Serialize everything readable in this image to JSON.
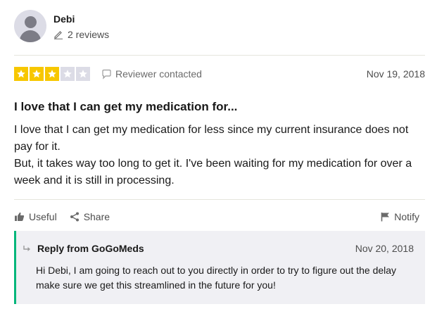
{
  "reviewer": {
    "name": "Debi",
    "review_count": "2 reviews",
    "avatar_icon": "user-avatar-icon"
  },
  "review": {
    "rating": 3,
    "rating_max": 5,
    "star_color": "#f7c700",
    "status": "Reviewer contacted",
    "date": "Nov 19, 2018",
    "title": "I love that I can get my medication for...",
    "body_line1": "I love that I can get my medication for less since my current insurance does not pay for it.",
    "body_line2": "But, it takes way too long to get it. I've been waiting for my medication for over a week and it is still in processing."
  },
  "actions": {
    "useful": "Useful",
    "share": "Share",
    "notify": "Notify"
  },
  "reply": {
    "title": "Reply from GoGoMeds",
    "date": "Nov 20, 2018",
    "text": "Hi Debi, I am going to reach out to you directly in order to try to figure out the delay make sure we get this streamlined in the future for you!",
    "accent_color": "#00b67a"
  }
}
